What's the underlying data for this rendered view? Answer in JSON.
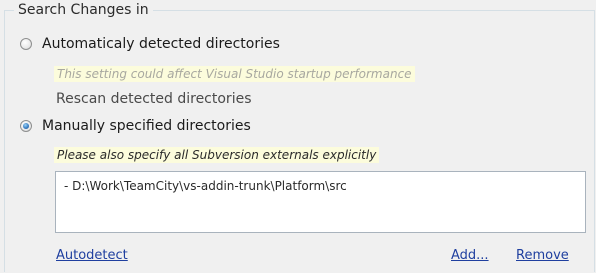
{
  "group": {
    "title": "Search Changes in"
  },
  "options": {
    "auto": {
      "label": "Automaticaly detected directories",
      "checked": false,
      "hint": "This setting could affect Visual Studio startup performance",
      "rescan_label": "Rescan detected directories"
    },
    "manual": {
      "label": "Manually specified directories",
      "checked": true,
      "hint": "Please also specify all Subversion externals explicitly"
    }
  },
  "directories": [
    {
      "path": "- D:\\Work\\TeamCity\\vs-addin-trunk\\Platform\\src"
    }
  ],
  "actions": {
    "autodetect": "Autodetect",
    "add": "Add...",
    "remove": "Remove"
  },
  "colors": {
    "hint_background": "#fcfcdc",
    "link": "#1f3f9f",
    "group_border": "#d5dfe5"
  }
}
